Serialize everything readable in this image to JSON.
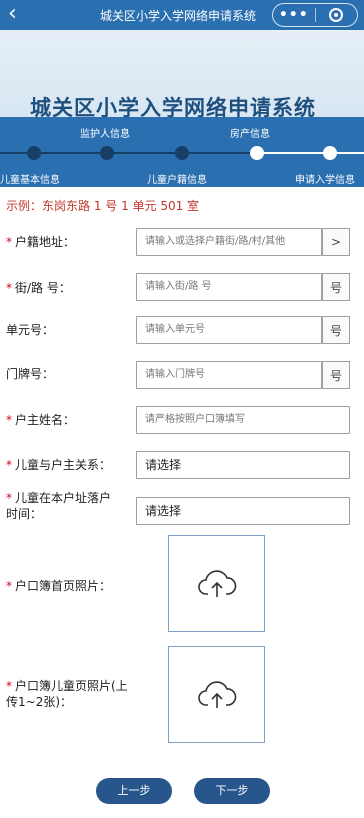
{
  "header": {
    "back_icon": "‹",
    "title": "城关区小学入学网络申请系统",
    "more_icon": "•••"
  },
  "banner": {
    "title": "城关区小学入学网络申请系统"
  },
  "steps": {
    "top": [
      "监护人信息",
      "房产信息"
    ],
    "bottom": [
      "儿童基本信息",
      "儿童户籍信息",
      "申请入学信息"
    ]
  },
  "example": "示例：东岗东路 1 号 1 单元 501 室",
  "form": {
    "address_label": "户籍地址：",
    "address_placeholder": "请输入或选择户籍街/路/村/其他",
    "address_suffix": ">",
    "street_label": "街/路 号：",
    "street_placeholder": "请输入街/路 号",
    "street_suffix": "号",
    "unit_label": "单元号：",
    "unit_placeholder": "请输入单元号",
    "unit_suffix": "号",
    "door_label": "门牌号：",
    "door_placeholder": "请输入门牌号",
    "door_suffix": "号",
    "owner_label": "户主姓名：",
    "owner_placeholder": "请严格按照户口簿填写",
    "relation_label": "儿童与户主关系：",
    "relation_value": "请选择",
    "settle_label_1": "儿童在本户址落户",
    "settle_label_2": "时间：",
    "settle_value": "请选择",
    "first_page_label": "户口簿首页照片：",
    "child_page_label_1": "户口簿儿童页照片(上",
    "child_page_label_2": "传1~2张)："
  },
  "buttons": {
    "prev": "上一步",
    "next": "下一步"
  },
  "colors": {
    "header_bg": "#2a6fb0",
    "button_bg": "#27568c",
    "required": "#d0021b",
    "example_text": "#c0392b"
  }
}
